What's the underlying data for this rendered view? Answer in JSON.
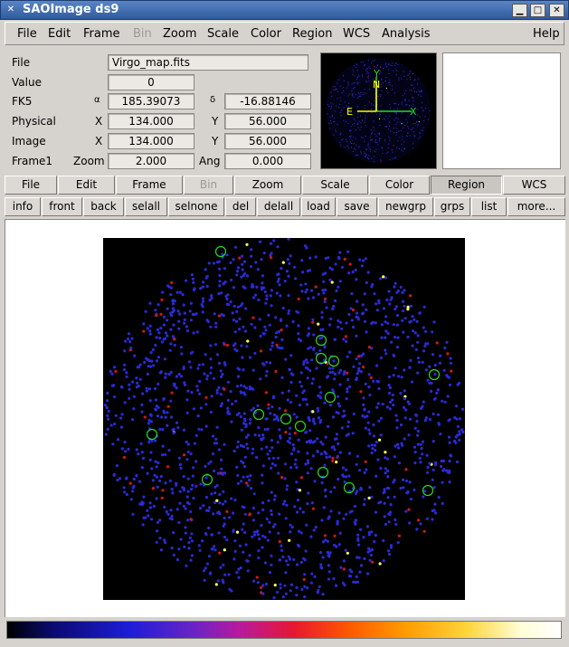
{
  "window": {
    "title": "SAOImage ds9",
    "app_icon": "x-icon"
  },
  "menubar": {
    "items": [
      "File",
      "Edit",
      "Frame",
      "Bin",
      "Zoom",
      "Scale",
      "Color",
      "Region",
      "WCS",
      "Analysis"
    ],
    "help": "Help",
    "disabled": [
      "Bin"
    ]
  },
  "info": {
    "file_label": "File",
    "file_value": "Virgo_map.fits",
    "value_label": "Value",
    "value_value": "0",
    "fk5_label": "FK5",
    "fk5_alpha_sym": "α",
    "fk5_alpha": "185.39073",
    "fk5_delta_sym": "δ",
    "fk5_delta": "-16.88146",
    "physical_label": "Physical",
    "physical_x_label": "X",
    "physical_x": "134.000",
    "physical_y_label": "Y",
    "physical_y": "56.000",
    "image_label": "Image",
    "image_x_label": "X",
    "image_x": "134.000",
    "image_y_label": "Y",
    "image_y": "56.000",
    "frame_label": "Frame1",
    "zoom_label": "Zoom",
    "zoom_value": "2.000",
    "ang_label": "Ang",
    "ang_value": "0.000"
  },
  "panner": {
    "n_label": "N",
    "e_label": "E",
    "x_label": "X",
    "y_label": "Y"
  },
  "buttonbar": {
    "items": [
      "File",
      "Edit",
      "Frame",
      "Bin",
      "Zoom",
      "Scale",
      "Color",
      "Region",
      "WCS"
    ],
    "active": "Region",
    "disabled": "Bin"
  },
  "region_bar": {
    "items": [
      "info",
      "front",
      "back",
      "selall",
      "selnone",
      "del",
      "delall",
      "load",
      "save",
      "newgrp",
      "grps",
      "list",
      "more..."
    ]
  },
  "regions": {
    "color": "#22dd22",
    "circles": [
      [
        130,
        15
      ],
      [
        241,
        113
      ],
      [
        241,
        133
      ],
      [
        255,
        136
      ],
      [
        366,
        151
      ],
      [
        251,
        176
      ],
      [
        172,
        195
      ],
      [
        202,
        200
      ],
      [
        218,
        208
      ],
      [
        54,
        217
      ],
      [
        243,
        259
      ],
      [
        115,
        267
      ],
      [
        272,
        276
      ],
      [
        359,
        279
      ]
    ]
  },
  "colorbar": {
    "colormap": "sls"
  }
}
